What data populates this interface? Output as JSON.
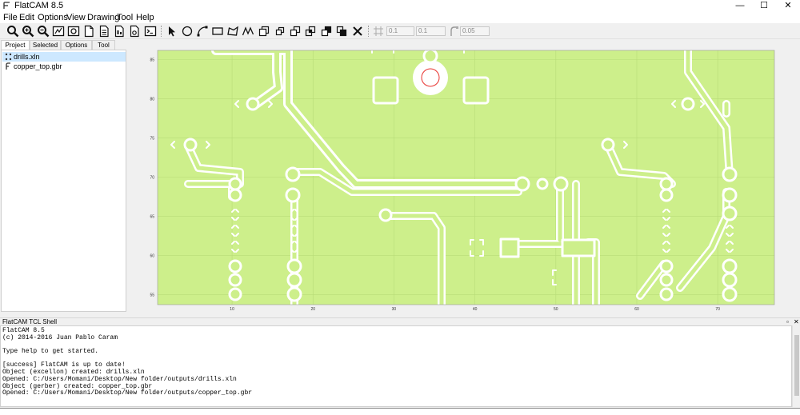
{
  "window": {
    "title": "FlatCAM 8.5",
    "controls": {
      "minimize": "—",
      "maximize": "☐",
      "close": "✕"
    }
  },
  "menu": [
    "File",
    "Edit",
    "Options",
    "View",
    "Drawing",
    "Tool",
    "Help"
  ],
  "toolbar": {
    "icons": [
      "zoom-fit-icon",
      "zoom-in-icon",
      "zoom-out-icon",
      "replot-icon",
      "clear-plot-icon",
      "new-file-icon",
      "open-file-icon",
      "open-gerber-icon",
      "open-excellon-icon",
      "tcl-shell-icon",
      "select-icon",
      "circle-icon",
      "arc-icon",
      "rectangle-icon",
      "polygon-icon",
      "path-icon",
      "move-icon",
      "copy-icon",
      "union-icon",
      "intersection-icon",
      "subtraction-icon",
      "cut-icon",
      "delete-icon"
    ],
    "grid_x": "0.1",
    "grid_y": "0.1",
    "snap_max": "0.05"
  },
  "tabs": [
    "Project",
    "Selected",
    "Options",
    "Tool"
  ],
  "active_tab": "Project",
  "project_items": [
    {
      "name": "drills.xln",
      "selected": true,
      "icon": "excellon-icon"
    },
    {
      "name": "copper_top.gbr",
      "selected": false,
      "icon": "gerber-icon"
    }
  ],
  "plot": {
    "background": "#cdef8b",
    "x_ticks": [
      "10",
      "20",
      "30",
      "40",
      "50",
      "60",
      "70"
    ],
    "y_ticks": [
      "85",
      "80",
      "75",
      "70",
      "65",
      "60",
      "55"
    ],
    "x_range": [
      0.8,
      77
    ],
    "y_range": [
      53.7,
      86.2
    ]
  },
  "shell": {
    "title": "FlatCAM TCL Shell",
    "undock": "▫",
    "close": "✕",
    "lines": [
      "FlatCAM 8.5",
      "(c) 2014-2016 Juan Pablo Caram",
      "",
      "Type help to get started.",
      "",
      "[success] FlatCAM is up to date!",
      "Object (excellon) created: drills.xln",
      "Opened: C:/Users/Momani/Desktop/New folder/outputs/drills.xln",
      "Object (gerber) created: copper_top.gbr",
      "Opened: C:/Users/Momani/Desktop/New folder/outputs/copper_top.gbr"
    ]
  }
}
